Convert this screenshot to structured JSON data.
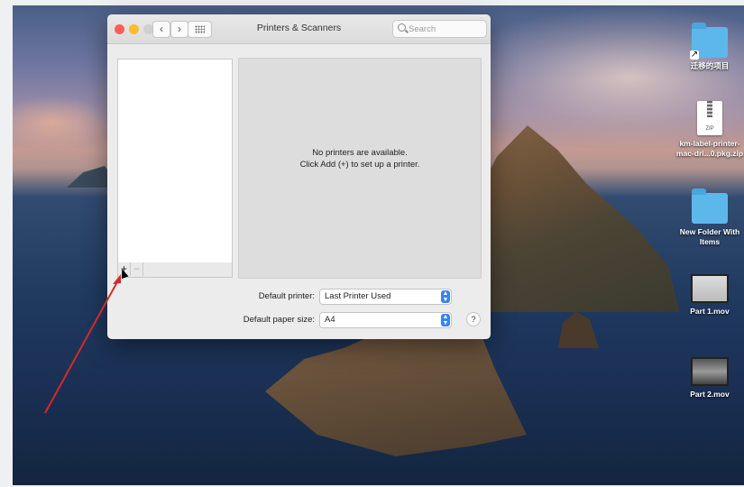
{
  "window": {
    "title": "Printers & Scanners",
    "search_placeholder": "Search",
    "nav_back": "‹",
    "nav_forward": "›"
  },
  "printer_list": {
    "add_label": "+",
    "remove_label": "–"
  },
  "detail": {
    "empty_line1": "No printers are available.",
    "empty_line2": "Click Add (+) to set up a printer."
  },
  "defaults": {
    "printer_label": "Default printer:",
    "printer_value": "Last Printer Used",
    "paper_label": "Default paper size:",
    "paper_value": "A4",
    "help_label": "?"
  },
  "desktop": {
    "items": [
      {
        "label": "迁移的项目",
        "type": "folder-alias"
      },
      {
        "label": "km-label-printer-mac-dri...0.pkg.zip",
        "type": "zip"
      },
      {
        "label": "New Folder With Items",
        "type": "folder"
      },
      {
        "label": "Part 1.mov",
        "type": "movie"
      },
      {
        "label": "Part 2.mov",
        "type": "movie"
      }
    ],
    "zip_badge": "ZIP"
  },
  "colors": {
    "accent": "#3b82f6",
    "annotation_arrow": "#d42a2a",
    "close": "#fc5f57",
    "minimize": "#fdbc2e"
  }
}
